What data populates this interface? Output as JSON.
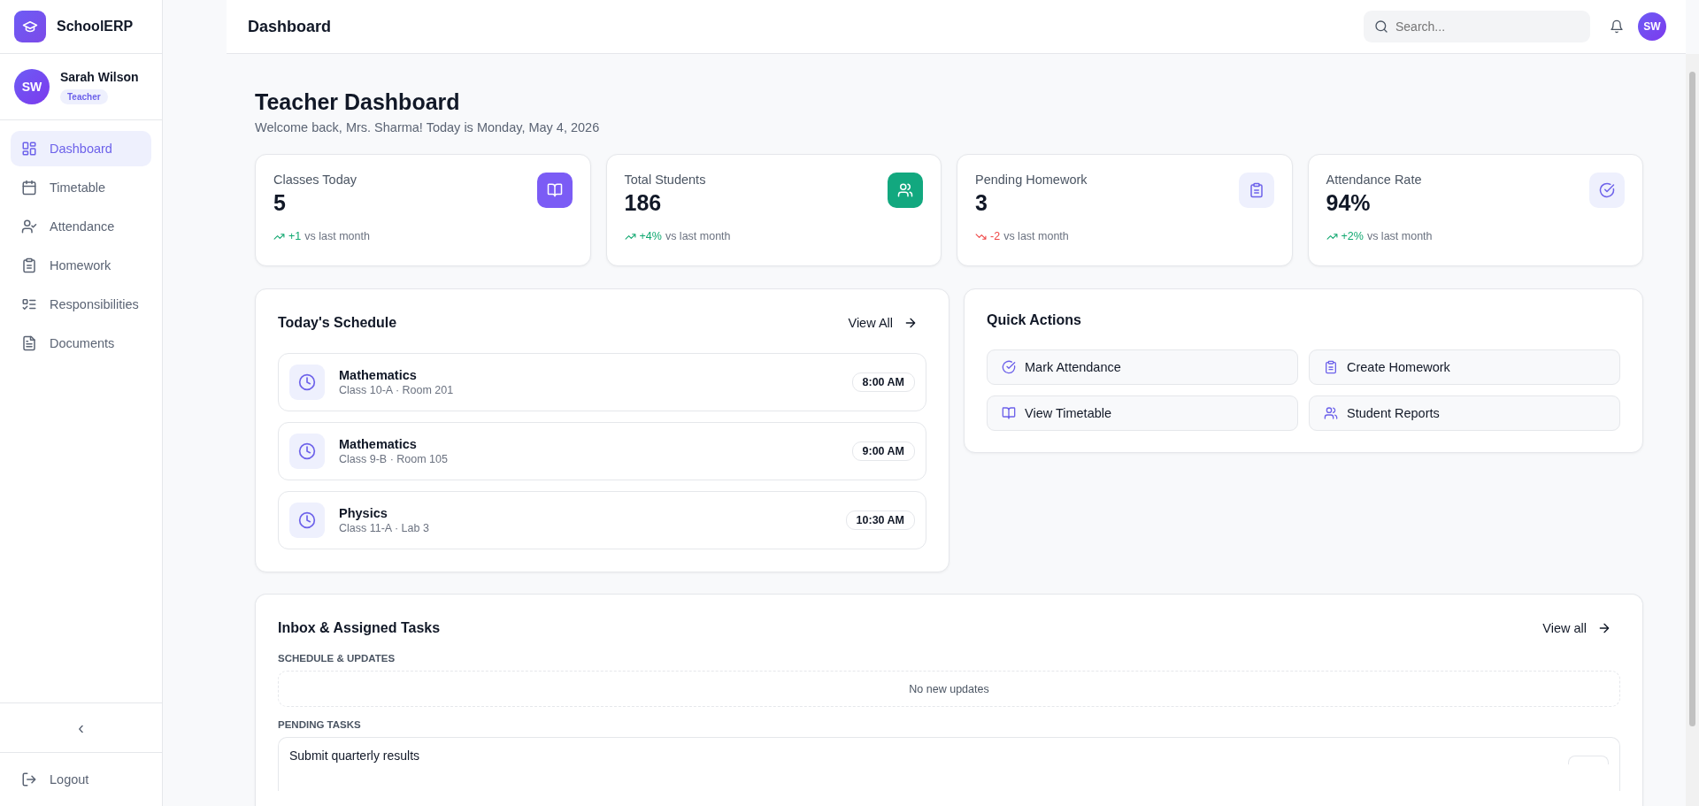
{
  "sidebar": {
    "brand": "SchoolERP",
    "user": {
      "initials": "SW",
      "name": "Sarah Wilson",
      "role": "Teacher"
    },
    "items": [
      {
        "label": "Dashboard",
        "selected": true
      },
      {
        "label": "Timetable",
        "selected": false
      },
      {
        "label": "Attendance",
        "selected": false
      },
      {
        "label": "Homework",
        "selected": false
      },
      {
        "label": "Responsibilities",
        "selected": false
      },
      {
        "label": "Documents",
        "selected": false
      }
    ],
    "collapse": "‹",
    "logout": "Logout"
  },
  "header": {
    "title": "Dashboard",
    "search": {
      "placeholder": "Search..."
    },
    "avatar": "SW"
  },
  "page": {
    "title": "Teacher Dashboard",
    "subtitle": "Welcome back, Mrs. Sharma! Today is Monday, May 4, 2026"
  },
  "stats": [
    {
      "label": "Classes Today",
      "value": "5",
      "negative": false,
      "change": "+1",
      "note": "vs last month",
      "highlighted": true,
      "color": "#7b5cf5"
    },
    {
      "label": "Total Students",
      "value": "186",
      "negative": false,
      "change": "+4%",
      "note": "vs last month",
      "highlighted": true,
      "color": "#12a87f"
    },
    {
      "label": "Pending Homework",
      "value": "3",
      "negative": true,
      "change": "-2",
      "note": "vs last month",
      "highlighted": false
    },
    {
      "label": "Attendance Rate",
      "value": "94%",
      "negative": false,
      "change": "+2%",
      "note": "vs last month",
      "highlighted": false
    }
  ],
  "schedule": {
    "title": "Today's Schedule",
    "link": "View All",
    "items": [
      {
        "subject": "Mathematics",
        "detail": "Class 10-A · Room 201",
        "time": "8:00 AM"
      },
      {
        "subject": "Mathematics",
        "detail": "Class 9-B · Room 105",
        "time": "9:00 AM"
      },
      {
        "subject": "Physics",
        "detail": "Class 11-A · Lab 3",
        "time": "10:30 AM"
      }
    ]
  },
  "quick_actions": {
    "title": "Quick Actions",
    "items": [
      "Mark Attendance",
      "Create Homework",
      "View Timetable",
      "Student Reports"
    ]
  },
  "inbox": {
    "title": "Inbox & Assigned Tasks",
    "link": "View all",
    "updates_heading": "SCHEDULE & UPDATES",
    "updates_empty": "No new updates",
    "tasks_heading": "PENDING TASKS",
    "tasks": [
      "Submit quarterly results"
    ]
  }
}
